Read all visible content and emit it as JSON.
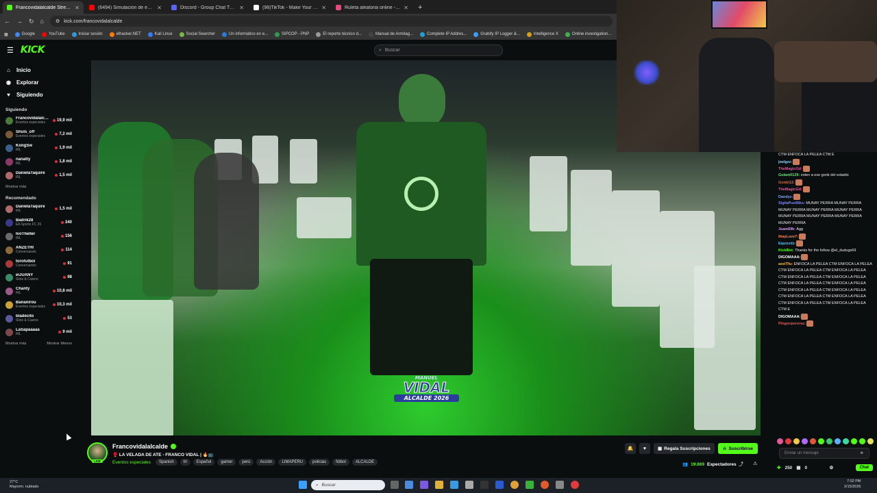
{
  "browser": {
    "tabs": [
      {
        "title": "Francovidalalcalde Stream",
        "color": "#53fc18",
        "active": true,
        "audio": true
      },
      {
        "title": "(6494) Simulación de examen II",
        "color": "#ff0000",
        "active": false
      },
      {
        "title": "Discord - Group Chat That's All",
        "color": "#5865f2",
        "active": false
      },
      {
        "title": "(98)TikTok - Make Your Day",
        "color": "#ffffff",
        "active": false
      },
      {
        "title": "Ruleta aleatoria online - ruleta",
        "color": "#e64a78",
        "active": false
      }
    ],
    "url": "kick.com/francovidalalcalde",
    "bookmarks": [
      {
        "label": "Google",
        "color": "#4285f4"
      },
      {
        "label": "YouTube",
        "color": "#ff0000"
      },
      {
        "label": "Iniciar sesión",
        "color": "#2c9ce0"
      },
      {
        "label": "elhacker.NET",
        "color": "#ff7a00"
      },
      {
        "label": "Kali Linux",
        "color": "#367bf0"
      },
      {
        "label": "Social Searcher",
        "color": "#7bb84a"
      },
      {
        "label": "Un informático en e...",
        "color": "#2c7ad6"
      },
      {
        "label": "SIPCOP - PNP",
        "color": "#2a9d4f"
      },
      {
        "label": "El reporte técnico d...",
        "color": "#999999"
      },
      {
        "label": "Manual de Armitag...",
        "color": "#444444"
      },
      {
        "label": "Complete IP Addres...",
        "color": "#1aa3d9"
      },
      {
        "label": "Grabify IP Logger &...",
        "color": "#3aa0ff"
      },
      {
        "label": "Intelligence X",
        "color": "#d4a017"
      },
      {
        "label": "Online investigation...",
        "color": "#3bb54a"
      }
    ]
  },
  "kick": {
    "logo": "KICK",
    "search_placeholder": "Buscar",
    "accent": "#53fc18"
  },
  "sidebar": {
    "nav": [
      {
        "label": "Inicio",
        "icon": "home-icon",
        "glyph": "⌂"
      },
      {
        "label": "Explorar",
        "icon": "compass-icon",
        "glyph": "◉"
      },
      {
        "label": "Siguiendo",
        "icon": "heart-icon",
        "glyph": "♥"
      }
    ],
    "following_title": "Siguiendo",
    "following": [
      {
        "name": "Francovidalalcalde",
        "cat": "Eventos especiales",
        "viewers": "19,9 mil",
        "color": "#4b7a3a"
      },
      {
        "name": "Shuls_off",
        "cat": "Eventos especiales",
        "viewers": "7,2 mil",
        "color": "#7a5a3a"
      },
      {
        "name": "KongSw",
        "cat": "IRL",
        "viewers": "1,9 mil",
        "color": "#3a5f8a"
      },
      {
        "name": "nanatty",
        "cat": "IRL",
        "viewers": "1,8 mil",
        "color": "#8a3a6a"
      },
      {
        "name": "DanielaTaquire",
        "cat": "IRL",
        "viewers": "1,5 mil",
        "color": "#b06a6a"
      }
    ],
    "show_more": "Mostrar más",
    "recommended_title": "Recomendado",
    "recommended": [
      {
        "name": "DanielaTaquire",
        "cat": "IRL",
        "viewers": "1,5 mil",
        "color": "#b06a6a"
      },
      {
        "name": "Badrik28",
        "cat": "EA Sports FC 26",
        "viewers": "340",
        "color": "#3a3a8a"
      },
      {
        "name": "IvoTheller",
        "cat": "IRL",
        "viewers": "156",
        "color": "#6a6a6a"
      },
      {
        "name": "ANZETHI",
        "cat": "Conversando",
        "viewers": "114",
        "color": "#8a6a3a"
      },
      {
        "name": "torofutbol",
        "cat": "Conversando",
        "viewers": "91",
        "color": "#aa3a3a"
      },
      {
        "name": "elJUANY",
        "cat": "Slots & Casino",
        "viewers": "98",
        "color": "#3a8a6a"
      },
      {
        "name": "Chanty",
        "cat": "IRL",
        "viewers": "10,8 mil",
        "color": "#9a5a8a"
      },
      {
        "name": "Bananirou",
        "cat": "Eventos especiales",
        "viewers": "10,3 mil",
        "color": "#c9a23a"
      },
      {
        "name": "bladecito",
        "cat": "Slots & Casino",
        "viewers": "53",
        "color": "#5a5a9a"
      },
      {
        "name": "LaSapaaaaa",
        "cat": "IRL",
        "viewers": "9 mil",
        "color": "#7a4a4a"
      }
    ],
    "show_more_2": "Mostrar más",
    "show_less": "Mostrar Menos"
  },
  "stream": {
    "overlay_top": "MANUEL",
    "overlay_main": "VIDAL",
    "overlay_sub": "ALCALDE 2026",
    "name": "Francovidalalcalde",
    "title": "🥊 LA VELADA DE ATE - FRANCO VIDAL | 🔥📺",
    "live": "LIVE",
    "category": "Eventos especiales",
    "tags": [
      "Spanish",
      "Irl",
      "Español",
      "gamer",
      "perú",
      "Acción",
      "LIMAPERU",
      "policias",
      "fútbol",
      "ALCALDE"
    ],
    "gift_label": "Regala Suscripciones",
    "sub_label": "Suscribirse",
    "viewers": "19.869",
    "viewers_label": "Espectadores"
  },
  "chat": {
    "messages": [
      {
        "user": "",
        "text": "CTM ENFOCA LA PELEA CTM E",
        "color": "#ffffff"
      },
      {
        "user": "joelgzz:",
        "text": "",
        "color": "#9ad8ff",
        "emote": true
      },
      {
        "user": "TheMagicGd:",
        "text": "",
        "color": "#e05aa0",
        "emote": true
      },
      {
        "user": "Gulam0129:",
        "text": "voten a ese gonk del estadio",
        "color": "#6ee27a"
      },
      {
        "user": "Gonbi12:",
        "text": "",
        "color": "#e06a3a",
        "emote": true
      },
      {
        "user": "TheMagicGd:",
        "text": "",
        "color": "#e05aa0",
        "emote": true
      },
      {
        "user": "Dandyz:",
        "text": "",
        "color": "#7aa6ff",
        "emote": true
      },
      {
        "user": "SigilaPue96ks:",
        "text": "MUNAY PERRA MUNAY PERRA MUNAY PERRA MUNAY PERRA MUNAY PERRA MUNAY PERRA MUNAY PERRA MUNAY PERRA MUNAY PERRA",
        "color": "#7a8aff"
      },
      {
        "user": "Jsam69k:",
        "text": "Agg",
        "color": "#d99aff"
      },
      {
        "user": "thayLuve7:",
        "text": "",
        "color": "#ff8a5a",
        "emote": true
      },
      {
        "user": "Equizzdz:",
        "text": "",
        "color": "#5ac8ff",
        "emote": true
      },
      {
        "user": "KickBot:",
        "text": "Thanks for the follow @el_dudugs69",
        "color": "#53fc18"
      },
      {
        "user": "DIGOMAAA:",
        "text": "",
        "color": "#ffffff",
        "emote": true
      },
      {
        "user": "axelTfu:",
        "text": "ENFOCA LA PELEA CTM ENFOCA LA PELEA CTM ENFOCA LA PELEA CTM ENFOCA LA PELEA CTM ENFOCA LA PELEA CTM ENFOCA LA PELEA CTM ENFOCA LA PELEA CTM ENFOCA LA PELEA CTM ENFOCA LA PELEA CTM ENFOCA LA PELEA CTM ENFOCA LA PELEA CTM ENFOCA LA PELEA CTM ENFOCA LA PELEA CTM ENFOCA LA PELEA CTM E",
        "color": "#ffb84a"
      },
      {
        "user": "DIGOMAAA:",
        "text": "",
        "color": "#ffffff",
        "emote": true
      },
      {
        "user": "Pingonpereraz:",
        "text": "",
        "color": "#e05a5a",
        "emote": true
      }
    ],
    "input_placeholder": "Enviar un mensaje",
    "points": "250",
    "count": "0",
    "chat_button": "Chat"
  },
  "taskbar": {
    "temp": "27°C",
    "weather": "Mayorm. nublado",
    "search_placeholder": "Buscar",
    "time": "7:02 PM",
    "date": "2/15/2026"
  }
}
